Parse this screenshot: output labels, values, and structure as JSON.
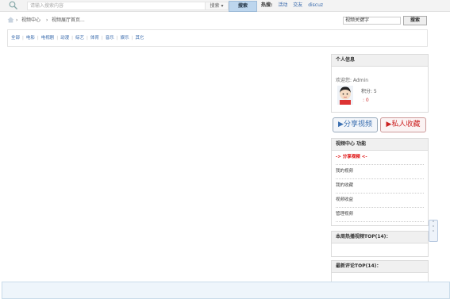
{
  "search": {
    "placeholder": "请输入搜索内容",
    "type_label": "搜索 ▾",
    "button_label": "搜索",
    "hot_label": "热搜:",
    "hot_links": [
      "活动",
      "交友",
      "discuz"
    ]
  },
  "breadcrumb": {
    "items": [
      "视频中心",
      "视频展厅首页..."
    ],
    "separator": "›"
  },
  "keyword_search": {
    "value": "视频关键字",
    "button_label": "搜索"
  },
  "categories": [
    "全部",
    "电影",
    "电视剧",
    "动漫",
    "综艺",
    "体育",
    "音乐",
    "娱乐",
    "其它"
  ],
  "user_panel": {
    "title": "个人信息",
    "welcome": "欢迎您: Admin",
    "score_label": "积分: 5",
    "score_value": ": 0"
  },
  "actions": {
    "share": "▶分享视频",
    "favorite": "▶私人收藏"
  },
  "video_menu": {
    "title": "视频中心 功能",
    "items": [
      "-> 分享视频 <-",
      "我的视频",
      "我的收藏",
      "视频收益",
      "管理视频"
    ]
  },
  "week_hot": {
    "title": "本周热播视频TOP(14)："
  },
  "latest_comments": {
    "title": "最新评论TOP(14)："
  },
  "scroll_hint": "⌃\n⌃"
}
